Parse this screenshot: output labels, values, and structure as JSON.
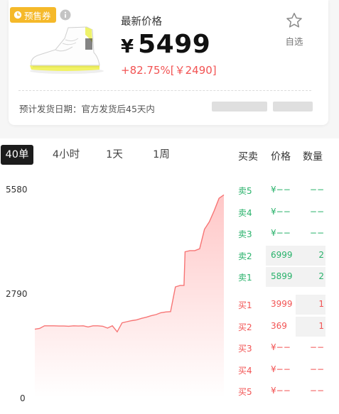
{
  "product": {
    "presale_badge": "预售券",
    "price_caption": "最新价格",
    "currency": "¥",
    "price": "5499",
    "price_change": "+82.75%[￥2490]",
    "favorite_label": "自选",
    "shipping_info": "预计发货日期：官方发货后45天内"
  },
  "tabs": [
    "40单",
    "4小时",
    "1天",
    "1周"
  ],
  "order_book": {
    "headers": {
      "type": "买卖",
      "price": "价格",
      "qty": "数量"
    },
    "sells": [
      {
        "type": "卖5",
        "price": "¥−−",
        "qty": "−−"
      },
      {
        "type": "卖4",
        "price": "¥−−",
        "qty": "−−"
      },
      {
        "type": "卖3",
        "price": "¥−−",
        "qty": "−−"
      },
      {
        "type": "卖2",
        "price": "6999",
        "qty": "2"
      },
      {
        "type": "卖1",
        "price": "5899",
        "qty": "2"
      }
    ],
    "buys": [
      {
        "type": "买1",
        "price": "3999",
        "qty": "1"
      },
      {
        "type": "买2",
        "price": "369",
        "qty": "1"
      },
      {
        "type": "买3",
        "price": "¥−−",
        "qty": "−−"
      },
      {
        "type": "买4",
        "price": "¥−−",
        "qty": "−−"
      },
      {
        "type": "买5",
        "price": "¥−−",
        "qty": "−−"
      }
    ]
  },
  "chart_data": {
    "type": "area",
    "y_ticks": [
      "5580",
      "2790",
      "0"
    ],
    "ylim": [
      0,
      5580
    ],
    "x": [
      0,
      1,
      2,
      3,
      4,
      5,
      6,
      7,
      8,
      9,
      10,
      11,
      12,
      13,
      14,
      15,
      16,
      17,
      18,
      19,
      20,
      21,
      22,
      23,
      24,
      25,
      26,
      27,
      28,
      29,
      30,
      31,
      32,
      33,
      34,
      35,
      36,
      37,
      38,
      39
    ],
    "values": [
      1830,
      1850,
      1920,
      1920,
      1920,
      1915,
      1915,
      1910,
      1920,
      1915,
      1920,
      1890,
      1920,
      1920,
      1910,
      1860,
      1920,
      1760,
      2000,
      2030,
      2060,
      2080,
      2120,
      2150,
      2190,
      2220,
      2270,
      2290,
      2300,
      2960,
      3000,
      3900,
      3930,
      3930,
      3980,
      4500,
      4700,
      5000,
      5330,
      5420
    ],
    "line_color": "#f77575",
    "fill_color": "#ffd9d9",
    "grid": false
  },
  "colors": {
    "badge": "#f5b92a",
    "sell": "#29b26b",
    "buy": "#f25353",
    "active_tab": "#1c1c1c"
  },
  "icons": {
    "badge": "clock-icon",
    "info": "info-icon",
    "favorite": "star-outline-icon"
  }
}
